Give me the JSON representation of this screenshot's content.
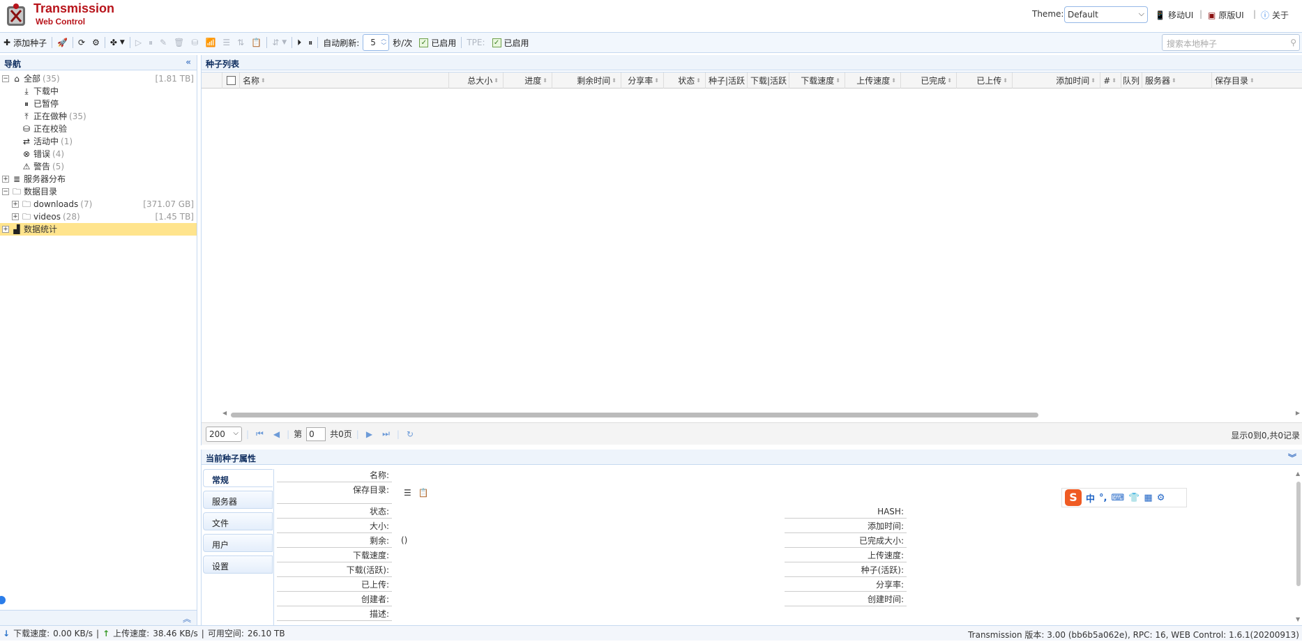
{
  "app": {
    "title": "Transmission",
    "subtitle": "Web Control"
  },
  "header": {
    "theme_label": "Theme:",
    "theme_value": "Default",
    "links": [
      "移动UI",
      "原版UI",
      "关于"
    ]
  },
  "toolbar": {
    "add_torrent": "添加种子",
    "auto_refresh_label": "自动刷新:",
    "refresh_interval": "5",
    "interval_unit": "秒/次",
    "enabled1": "已启用",
    "tpe_label": "TPE:",
    "enabled2": "已启用",
    "search_placeholder": "搜索本地种子"
  },
  "nav": {
    "title": "导航",
    "items": [
      {
        "label": "全部",
        "count": "(35)",
        "size": "[1.81 TB]"
      },
      {
        "label": "下载中",
        "count": "",
        "size": ""
      },
      {
        "label": "已暂停",
        "count": "",
        "size": ""
      },
      {
        "label": "正在做种",
        "count": "(35)",
        "size": ""
      },
      {
        "label": "正在校验",
        "count": "",
        "size": ""
      },
      {
        "label": "活动中",
        "count": "(1)",
        "size": ""
      },
      {
        "label": "错误",
        "count": "(4)",
        "size": ""
      },
      {
        "label": "警告",
        "count": "(5)",
        "size": ""
      },
      {
        "label": "服务器分布",
        "count": "",
        "size": ""
      },
      {
        "label": "数据目录",
        "count": "",
        "size": ""
      },
      {
        "label": "downloads",
        "count": "(7)",
        "size": "[371.07 GB]"
      },
      {
        "label": "videos",
        "count": "(28)",
        "size": "[1.45 TB]"
      },
      {
        "label": "数据统计",
        "count": "",
        "size": ""
      }
    ]
  },
  "list": {
    "title": "种子列表",
    "columns": [
      "名称",
      "总大小",
      "进度",
      "剩余时间",
      "分享率",
      "状态",
      "种子|活跃",
      "下载|活跃",
      "下载速度",
      "上传速度",
      "已完成",
      "已上传",
      "添加时间",
      "#",
      "队列",
      "服务器",
      "保存目录"
    ],
    "page_size": "200",
    "page_prefix": "第",
    "page_value": "0",
    "page_total": "共0页",
    "records_info": "显示0到0,共0记录"
  },
  "props": {
    "title": "当前种子属性",
    "tabs": [
      "常规",
      "服务器",
      "文件",
      "用户",
      "设置"
    ],
    "left_fields": [
      "名称:",
      "保存目录:",
      "状态:",
      "大小:",
      "剩余:",
      "下载速度:",
      "下载(活跃):",
      "已上传:",
      "创建者:",
      "描述:"
    ],
    "right_fields": [
      "HASH:",
      "添加时间:",
      "已完成大小:",
      "上传速度:",
      "种子(活跃):",
      "分享率:",
      "创建时间:"
    ],
    "remaining_value": "()"
  },
  "ime": {
    "items": [
      "中",
      "°,",
      "⌨",
      "👕",
      "▦",
      "⚙"
    ]
  },
  "status": {
    "dl_label": "下载速度:",
    "dl_value": "0.00 KB/s",
    "ul_label": "上传速度:",
    "ul_value": "38.46 KB/s",
    "free_label": "可用空间:",
    "free_value": "26.10 TB",
    "version": "Transmission 版本: 3.00 (bb6b5a062e), RPC: 16, WEB Control: 1.6.1(20200913)"
  },
  "colors": {
    "brand": "#b8141b",
    "panel_border": "#c6d9f0",
    "selected": "#ffe48d"
  }
}
